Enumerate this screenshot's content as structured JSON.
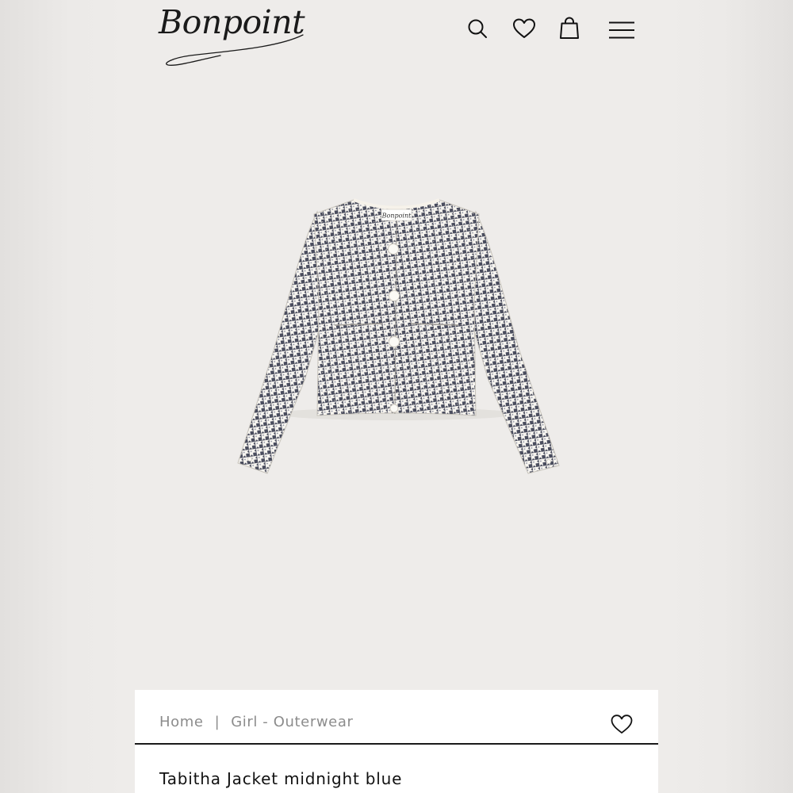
{
  "header": {
    "logo_text": "Bonpoint",
    "icons": [
      "search-icon",
      "heart-icon",
      "shopping-bag-icon",
      "menu-icon"
    ]
  },
  "product": {
    "breadcrumb": {
      "home": "Home",
      "separator": "|",
      "category": "Girl - Outerwear"
    },
    "title": "Tabitha Jacket midnight blue",
    "image_label": "Bonpoint"
  },
  "colors": {
    "page_background": "#eeecea",
    "info_background": "#ffffff",
    "text_primary": "#111111",
    "text_muted": "#8c8c8c",
    "pattern_dark": "#4a4d5e",
    "pattern_light": "#f7f5f0"
  }
}
